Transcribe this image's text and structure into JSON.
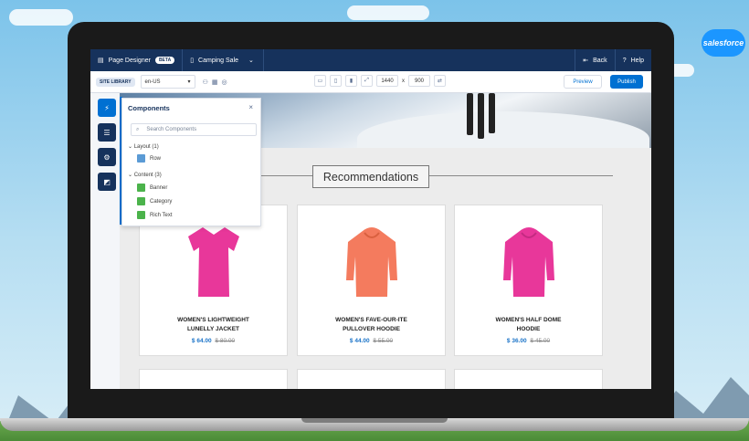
{
  "brand": {
    "logo_text": "salesforce"
  },
  "topnav": {
    "app_name": "Page Designer",
    "beta_badge": "BETA",
    "page_name": "Camping Sale",
    "back_label": "Back",
    "help_label": "Help"
  },
  "toolbar": {
    "site_library": "SITE LIBRARY",
    "locale": "en-US",
    "width": "1440",
    "times": "x",
    "height": "900",
    "preview_label": "Preview",
    "publish_label": "Publish"
  },
  "panel": {
    "title": "Components",
    "close": "×",
    "search_placeholder": "Search Components",
    "groups": [
      {
        "label": "Layout (1)",
        "items": [
          {
            "label": "Row"
          }
        ]
      },
      {
        "label": "Content (3)",
        "items": [
          {
            "label": "Banner"
          },
          {
            "label": "Category"
          },
          {
            "label": "Rich Text"
          }
        ]
      }
    ]
  },
  "section": {
    "title": "Recommendations"
  },
  "products": [
    {
      "name_line1": "WOMEN'S LIGHTWEIGHT",
      "name_line2": "LUNELLY JACKET",
      "sale_price": "$ 64.00",
      "orig_price": "$ 80.00",
      "color": "#e8379a"
    },
    {
      "name_line1": "WOMEN'S FAVE-OUR-ITE",
      "name_line2": "PULLOVER HOODIE",
      "sale_price": "$ 44.00",
      "orig_price": "$ 55.00",
      "color": "#f47b5e"
    },
    {
      "name_line1": "WOMEN'S HALF DOME",
      "name_line2": "HOODIE",
      "sale_price": "$ 36.00",
      "orig_price": "$ 45.00",
      "color": "#e8379a"
    }
  ],
  "colors": {
    "nav": "#16325c",
    "accent": "#0070d2"
  }
}
